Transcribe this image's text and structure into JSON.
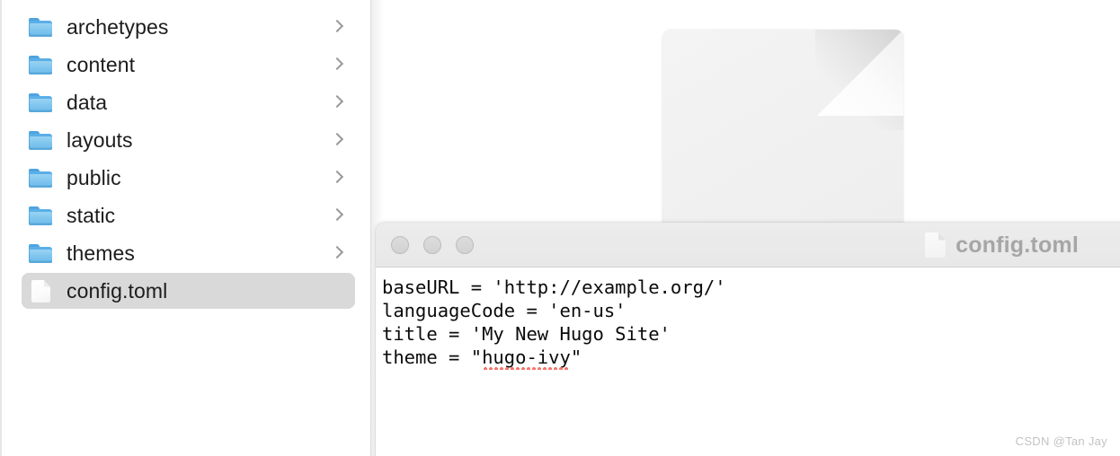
{
  "sidebar": {
    "items": [
      {
        "label": "archetypes",
        "icon": "folder-icon",
        "kind": "folder",
        "selected": false,
        "has_chevron": true
      },
      {
        "label": "content",
        "icon": "folder-icon",
        "kind": "folder",
        "selected": false,
        "has_chevron": true
      },
      {
        "label": "data",
        "icon": "folder-icon",
        "kind": "folder",
        "selected": false,
        "has_chevron": true
      },
      {
        "label": "layouts",
        "icon": "folder-icon",
        "kind": "folder",
        "selected": false,
        "has_chevron": true
      },
      {
        "label": "public",
        "icon": "folder-icon",
        "kind": "folder",
        "selected": false,
        "has_chevron": true
      },
      {
        "label": "static",
        "icon": "folder-icon",
        "kind": "folder",
        "selected": false,
        "has_chevron": true
      },
      {
        "label": "themes",
        "icon": "folder-icon",
        "kind": "folder",
        "selected": false,
        "has_chevron": true
      },
      {
        "label": "config.toml",
        "icon": "document-icon",
        "kind": "file",
        "selected": true,
        "has_chevron": false
      }
    ]
  },
  "background": {
    "preview_icon": "large-document-icon"
  },
  "window": {
    "title": "config.toml",
    "title_icon": "document-icon",
    "traffic_lights": [
      "close-button",
      "minimize-button",
      "maximize-button"
    ],
    "code_lines": [
      {
        "text": "baseURL = 'http://example.org/'",
        "misspelled": null
      },
      {
        "text": "languageCode = 'en-us'",
        "misspelled": null
      },
      {
        "text": "title = 'My New Hugo Site'",
        "misspelled": null
      },
      {
        "text": "theme = \"",
        "misspelled": "hugo-ivy",
        "suffix": "\""
      }
    ]
  },
  "watermark": {
    "text": "CSDN @Tan Jay"
  },
  "colors": {
    "folder_blue": "#7cc4ee",
    "selection_gray": "#d9d9d9",
    "titlebar_gray": "#ececec",
    "spellcheck_red": "#f4776b",
    "title_text_gray": "#a6a6a6"
  }
}
